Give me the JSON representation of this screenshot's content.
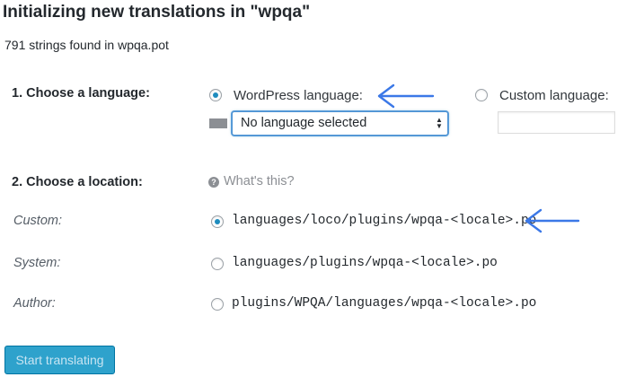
{
  "header": {
    "title": "Initializing new translations in \"wpqa\""
  },
  "summary": "791 strings found in wpqa.pot",
  "language": {
    "step_label": "1. Choose a language:",
    "wordpress_option": "WordPress language:",
    "custom_option": "Custom language:",
    "selected_value": "No language selected",
    "custom_value": ""
  },
  "location": {
    "step_label": "2. Choose a location:",
    "help_text": "What's this?",
    "options": [
      {
        "label": "Custom:",
        "path": "languages/loco/plugins/wpqa-<locale>.po",
        "selected": true
      },
      {
        "label": "System:",
        "path": "languages/plugins/wpqa-<locale>.po",
        "selected": false
      },
      {
        "label": "Author:",
        "path": "plugins/WPQA/languages/wpqa-<locale>.po",
        "selected": false
      }
    ]
  },
  "actions": {
    "start_label": "Start translating"
  },
  "colors": {
    "accent": "#1e8cbe",
    "button": "#2ea2cc",
    "arrow": "#3b78e7"
  },
  "annotations": [
    "arrow-icon",
    "arrow-icon"
  ]
}
